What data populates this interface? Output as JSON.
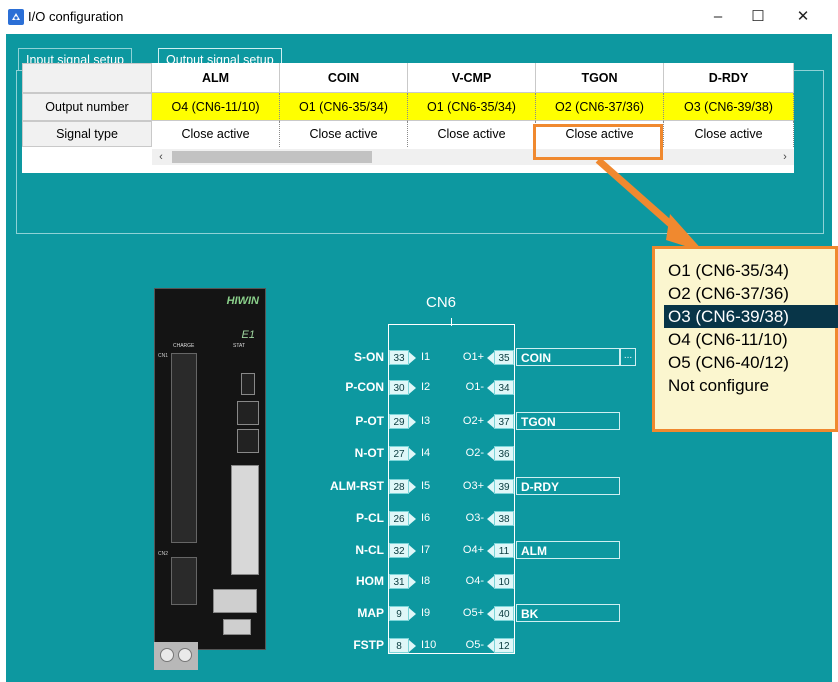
{
  "window": {
    "title": "I/O configuration",
    "minimize": "–",
    "maximize": "☐",
    "close": "✕"
  },
  "tabs": [
    {
      "label": "Input signal setup",
      "active": false
    },
    {
      "label": "Output signal setup",
      "active": true
    }
  ],
  "table": {
    "row_labels": [
      "Output number",
      "Signal type"
    ],
    "columns": [
      {
        "header": "ALM",
        "output": "O4 (CN6-11/10)",
        "signal": "Close active"
      },
      {
        "header": "COIN",
        "output": "O1 (CN6-35/34)",
        "signal": "Close active"
      },
      {
        "header": "V-CMP",
        "output": "O1 (CN6-35/34)",
        "signal": "Close active"
      },
      {
        "header": "TGON",
        "output": "O2 (CN6-37/36)",
        "signal": "Close active"
      },
      {
        "header": "D-RDY",
        "output": "O3 (CN6-39/38)",
        "signal": "Close active"
      }
    ],
    "scroll_left": "‹",
    "scroll_right": "›"
  },
  "dropdown": {
    "options": [
      "O1 (CN6-35/34)",
      "O2 (CN6-37/36)",
      "O3 (CN6-39/38)",
      "O4 (CN6-11/10)",
      "O5 (CN6-40/12)",
      "Not configure"
    ],
    "selected_index": 2
  },
  "drive": {
    "brand": "HIWIN",
    "model": "E1",
    "charge_label": "CHARGE",
    "stat_label": "STAT",
    "cn1_label": "CN1",
    "cn2_label": "CN2"
  },
  "cn6": {
    "title": "CN6",
    "inputs": [
      {
        "signal": "S-ON",
        "pin": "33",
        "label": "I1"
      },
      {
        "signal": "P-CON",
        "pin": "30",
        "label": "I2"
      },
      {
        "signal": "P-OT",
        "pin": "29",
        "label": "I3"
      },
      {
        "signal": "N-OT",
        "pin": "27",
        "label": "I4"
      },
      {
        "signal": "ALM-RST",
        "pin": "28",
        "label": "I5"
      },
      {
        "signal": "P-CL",
        "pin": "26",
        "label": "I6"
      },
      {
        "signal": "N-CL",
        "pin": "32",
        "label": "I7"
      },
      {
        "signal": "HOM",
        "pin": "31",
        "label": "I8"
      },
      {
        "signal": "MAP",
        "pin": "9",
        "label": "I9"
      },
      {
        "signal": "FSTP",
        "pin": "8",
        "label": "I10"
      }
    ],
    "outputs": [
      {
        "label": "O1+",
        "pin": "35",
        "assigned": "COIN"
      },
      {
        "label": "O1-",
        "pin": "34",
        "assigned": ""
      },
      {
        "label": "O2+",
        "pin": "37",
        "assigned": "TGON"
      },
      {
        "label": "O2-",
        "pin": "36",
        "assigned": ""
      },
      {
        "label": "O3+",
        "pin": "39",
        "assigned": "D-RDY"
      },
      {
        "label": "O3-",
        "pin": "38",
        "assigned": ""
      },
      {
        "label": "O4+",
        "pin": "11",
        "assigned": "ALM"
      },
      {
        "label": "O4-",
        "pin": "10",
        "assigned": ""
      },
      {
        "label": "O5+",
        "pin": "40",
        "assigned": "BK"
      },
      {
        "label": "O5-",
        "pin": "12",
        "assigned": ""
      }
    ],
    "more_button": "..."
  },
  "colors": {
    "background": "#0d98a0",
    "highlight": "#f0892f",
    "output_cell": "#ffff00",
    "dropdown_selected": "#083548"
  }
}
